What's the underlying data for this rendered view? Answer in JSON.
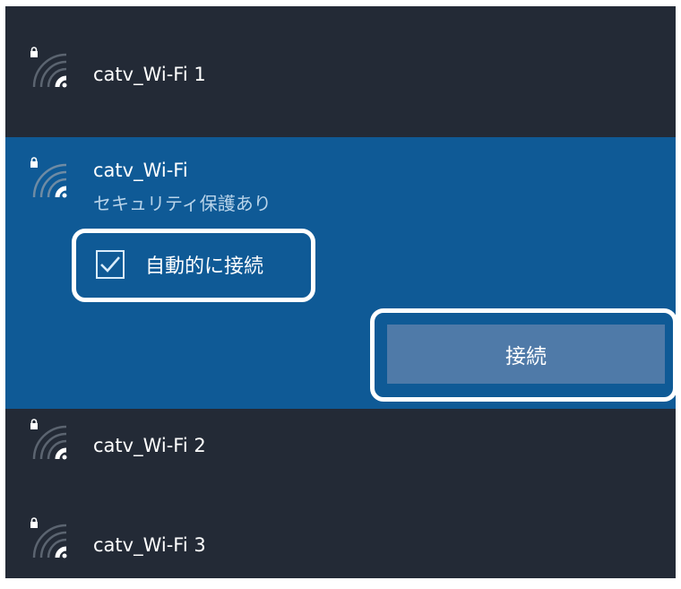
{
  "colors": {
    "panel_background": "#232a36",
    "selected_background": "#0f5a96",
    "button_background": "#4f7aa8",
    "secondary_text": "#b9d4ea",
    "highlight_outline": "#ffffff"
  },
  "networks": [
    {
      "name": "catv_Wi-Fi 1",
      "lock_icon": "lock-icon",
      "signal_icon": "wifi-signal-icon"
    },
    {
      "name": "catv_Wi-Fi",
      "status": "セキュリティ保護あり",
      "auto_connect_label": "自動的に接続",
      "auto_connect_checked": true,
      "connect_label": "接続",
      "lock_icon": "lock-icon",
      "signal_icon": "wifi-signal-icon",
      "check_icon": "check-icon"
    },
    {
      "name": "catv_Wi-Fi 2",
      "lock_icon": "lock-icon",
      "signal_icon": "wifi-signal-icon"
    },
    {
      "name": "catv_Wi-Fi 3",
      "lock_icon": "lock-icon",
      "signal_icon": "wifi-signal-icon"
    }
  ]
}
